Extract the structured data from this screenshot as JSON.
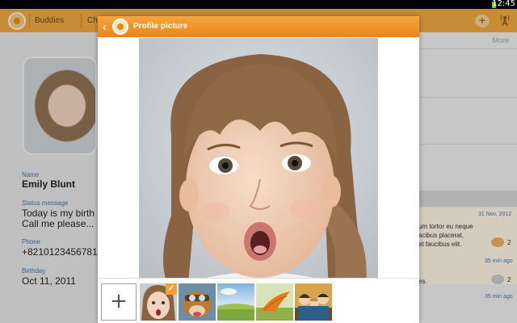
{
  "status_bar": {
    "time": "12:45"
  },
  "app_bar": {
    "tabs": [
      "Buddies",
      "Ch"
    ]
  },
  "profile": {
    "name_label": "Name",
    "name": "Emily Blunt",
    "status_label": "Status message",
    "status_line1": "Today is my birth",
    "status_line2": "Call me please...",
    "phone_label": "Phone",
    "phone": "+8210123456781",
    "birthday_label": "Birthday",
    "birthday": "Oct 11, 2011"
  },
  "right_panel": {
    "more_label": "More",
    "date": "31 Nov, 2012",
    "msg_line1": "um tortor eu neque",
    "msg_line2": "acibus placerat,",
    "msg_line3": "et faucibus elit.",
    "count1": "2",
    "time1": "35 min ago",
    "msg_line4": "es.",
    "count2": "2",
    "time2": "35 min ago"
  },
  "dialog": {
    "title": "Profile picture",
    "add_label": "+"
  },
  "colors": {
    "accent": "#eea435",
    "header_gradient_top": "#f6a53c",
    "header_gradient_bottom": "#e9851a",
    "label_blue": "#3a6ea0"
  }
}
